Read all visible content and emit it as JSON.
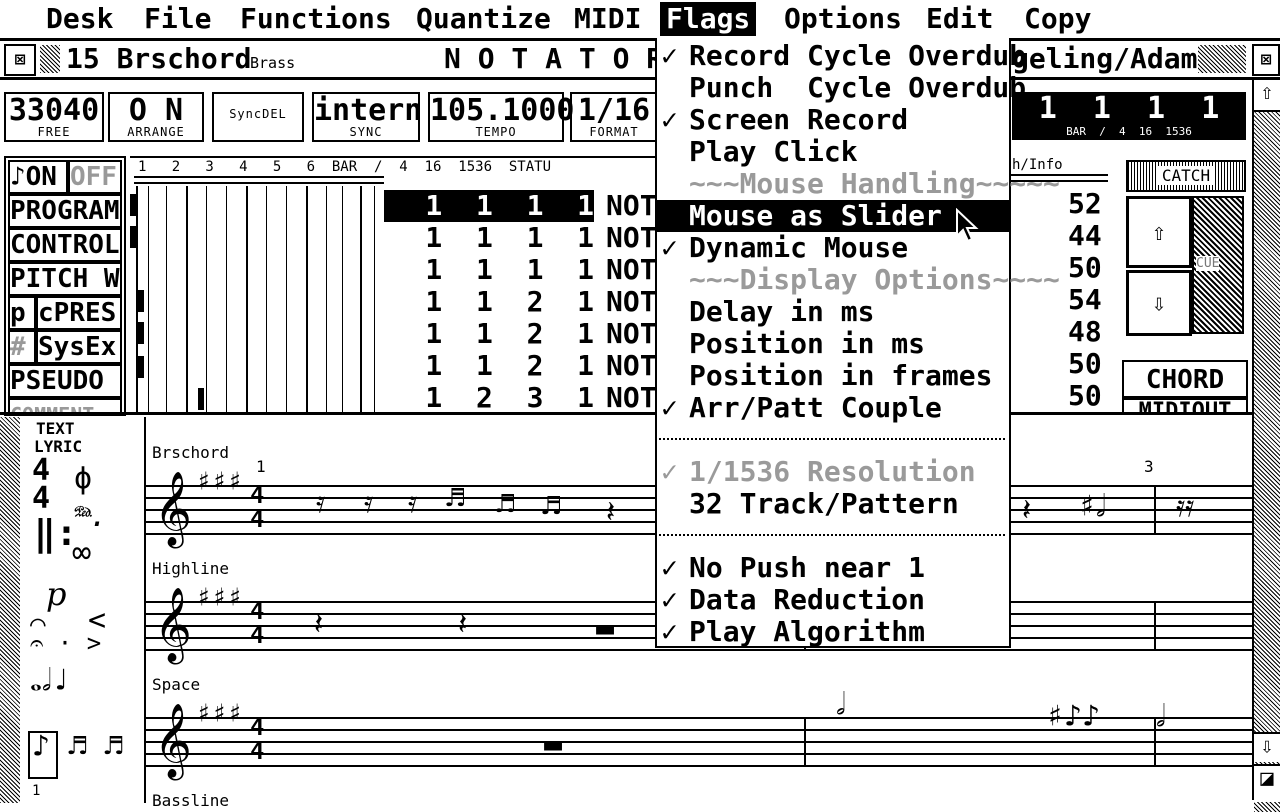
{
  "menubar": {
    "items": [
      "Desk",
      "File",
      "Functions",
      "Quantize",
      "MIDI",
      "Flags",
      "Options",
      "Edit",
      "Copy"
    ],
    "active": "Flags"
  },
  "titlebar": {
    "track": "15 Brschord",
    "instrument": "Brass",
    "app": "N O T A T O R",
    "song": "geling/Adam"
  },
  "displays": {
    "free": {
      "value": "33040",
      "label": "FREE"
    },
    "arrange": {
      "value": "O N",
      "label": "ARRANGE"
    },
    "syncdel": {
      "value": "",
      "label": "SyncDEL"
    },
    "sync": {
      "value": "intern",
      "label": "SYNC"
    },
    "tempo": {
      "value": "105.1000",
      "label": "TEMPO"
    },
    "format": {
      "value": "1/16",
      "label": "FORMAT"
    },
    "position": {
      "value": "1  1  1  1",
      "label": "BAR  /  4  16  1536"
    }
  },
  "left_buttons": {
    "on": "♪ON",
    "off": "OFF",
    "program": "PROGRAM",
    "control": "CONTROL",
    "pitch": "PITCH W",
    "p": "p",
    "cpres": "cPRES",
    "sharp": "#",
    "sysex": "SysEx",
    "pseudo": "PSEUDO",
    "comment": "COMMENT"
  },
  "event_header": "1   2   3   4   5   6  BAR  /  4  16  1536  STATU",
  "event_header_right": "h/Info",
  "events": [
    {
      "pos": "1  1  1  1",
      "status": "NOT",
      "info": "52",
      "selected": true
    },
    {
      "pos": "1  1  1  1",
      "status": "NOT",
      "info": "44",
      "selected": false
    },
    {
      "pos": "1  1  1  1",
      "status": "NOT",
      "info": "50",
      "selected": false
    },
    {
      "pos": "1  1  2  1",
      "status": "NOT",
      "info": "54",
      "selected": false
    },
    {
      "pos": "1  1  2  1",
      "status": "NOT",
      "info": "48",
      "selected": false
    },
    {
      "pos": "1  1  2  1",
      "status": "NOT",
      "info": "50",
      "selected": false
    },
    {
      "pos": "1  2  3  1",
      "status": "NOT",
      "info": "50",
      "selected": false
    }
  ],
  "right_panel": {
    "catch": "CATCH",
    "cue": "CUE",
    "chord": "CHORD",
    "midiout": "MIDIOUT"
  },
  "flags_menu": [
    {
      "type": "item",
      "label": "Record Cycle Overdub",
      "checked": true,
      "disabled": false,
      "highlight": false
    },
    {
      "type": "item",
      "label": "Punch  Cycle Overdub",
      "checked": false,
      "disabled": false,
      "highlight": false
    },
    {
      "type": "item",
      "label": "Screen Record",
      "checked": true,
      "disabled": false,
      "highlight": false
    },
    {
      "type": "item",
      "label": "Play Click",
      "checked": false,
      "disabled": false,
      "highlight": false
    },
    {
      "type": "item",
      "label": "~~~Mouse Handling~~~~~",
      "checked": false,
      "disabled": true,
      "highlight": false
    },
    {
      "type": "item",
      "label": "Mouse as Slider",
      "checked": false,
      "disabled": false,
      "highlight": true
    },
    {
      "type": "item",
      "label": "Dynamic Mouse",
      "checked": true,
      "disabled": false,
      "highlight": false
    },
    {
      "type": "item",
      "label": "~~~Display Options~~~~",
      "checked": false,
      "disabled": true,
      "highlight": false
    },
    {
      "type": "item",
      "label": "Delay in ms",
      "checked": false,
      "disabled": false,
      "highlight": false
    },
    {
      "type": "item",
      "label": "Position in ms",
      "checked": false,
      "disabled": false,
      "highlight": false
    },
    {
      "type": "item",
      "label": "Position in frames",
      "checked": false,
      "disabled": false,
      "highlight": false
    },
    {
      "type": "item",
      "label": "Arr/Patt Couple",
      "checked": true,
      "disabled": false,
      "highlight": false
    },
    {
      "type": "sep"
    },
    {
      "type": "item",
      "label": "1/1536 Resolution",
      "checked": true,
      "disabled": true,
      "highlight": false
    },
    {
      "type": "item",
      "label": "32 Track/Pattern",
      "checked": false,
      "disabled": false,
      "highlight": false
    },
    {
      "type": "sep"
    },
    {
      "type": "item",
      "label": "No Push near 1",
      "checked": true,
      "disabled": false,
      "highlight": false
    },
    {
      "type": "item",
      "label": "Data Reduction",
      "checked": true,
      "disabled": false,
      "highlight": false
    },
    {
      "type": "item",
      "label": "Play Algorithm",
      "checked": true,
      "disabled": false,
      "highlight": false
    }
  ],
  "palette": {
    "text": "TEXT",
    "lyric": "LYRIC",
    "bottom_num": "1"
  },
  "score": {
    "staves": [
      "Brschord",
      "Highline",
      "Space",
      "Bassline"
    ],
    "bar1": "1",
    "bar3": "3"
  }
}
